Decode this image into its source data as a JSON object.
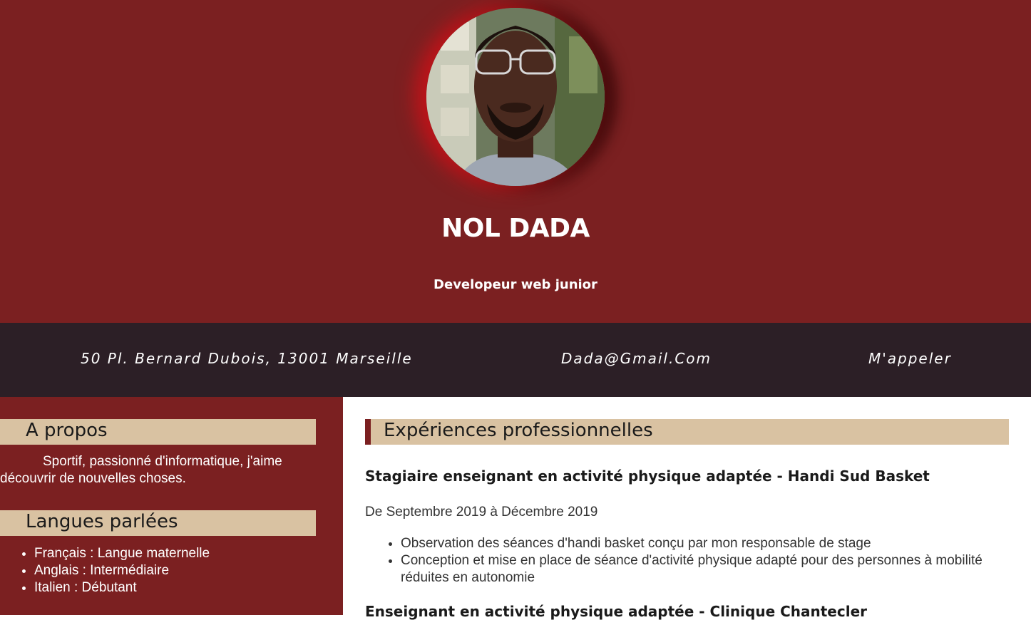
{
  "header": {
    "name": "NOL DADA",
    "role": "Developeur web junior",
    "photo_alt": "profile-photo",
    "background_color": "#7b2021"
  },
  "contact": {
    "address": "50 Pl. Bernard Dubois, 13001 Marseille",
    "email": "Dada@Gmail.Com",
    "call": "M'appeler",
    "background_color": "#2c1f26"
  },
  "sidebar": {
    "about": {
      "heading": "A propos",
      "text": "Sportif, passionné d'informatique, j'aime découvrir de nouvelles choses."
    },
    "languages": {
      "heading": "Langues parlées",
      "items": [
        "Français : Langue maternelle",
        "Anglais : Intermédiaire",
        "Italien : Débutant"
      ]
    },
    "heading_color": "#d9c2a2"
  },
  "main": {
    "experience": {
      "heading": "Expériences professionnelles",
      "jobs": [
        {
          "title": "Stagiaire enseignant en activité physique adaptée - Handi Sud Basket",
          "dates": "De Septembre 2019 à Décembre 2019",
          "tasks": [
            "Observation des séances d'handi basket conçu par mon responsable de stage",
            "Conception et mise en place de séance d'activité physique adapté pour des personnes à mobilité réduites en autonomie"
          ]
        },
        {
          "title": "Enseignant en activité physique adaptée - Clinique Chantecler"
        }
      ]
    }
  }
}
